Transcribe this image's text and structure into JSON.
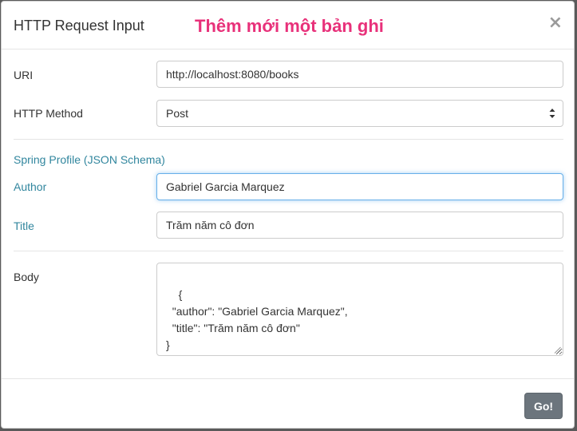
{
  "header": {
    "title": "HTTP Request Input",
    "annotation": "Thêm mới một bản ghi",
    "close_label": "×"
  },
  "form": {
    "uri": {
      "label": "URI",
      "value": "http://localhost:8080/books"
    },
    "method": {
      "label": "HTTP Method",
      "value": "Post"
    },
    "profile": {
      "title": "Spring Profile (JSON Schema)",
      "author": {
        "label": "Author",
        "value": "Gabriel Garcia Marquez"
      },
      "title_field": {
        "label": "Title",
        "value": "Trăm năm cô đơn"
      }
    },
    "body": {
      "label": "Body",
      "value": "{\n  \"author\": \"Gabriel Garcia Marquez\",\n  \"title\": \"Trăm năm cô đơn\"\n}"
    }
  },
  "footer": {
    "go_label": "Go!"
  },
  "colors": {
    "accent_label": "#31869e",
    "annotation": "#e8317a",
    "button": "#6c757d",
    "focus_border": "#66afe9"
  }
}
